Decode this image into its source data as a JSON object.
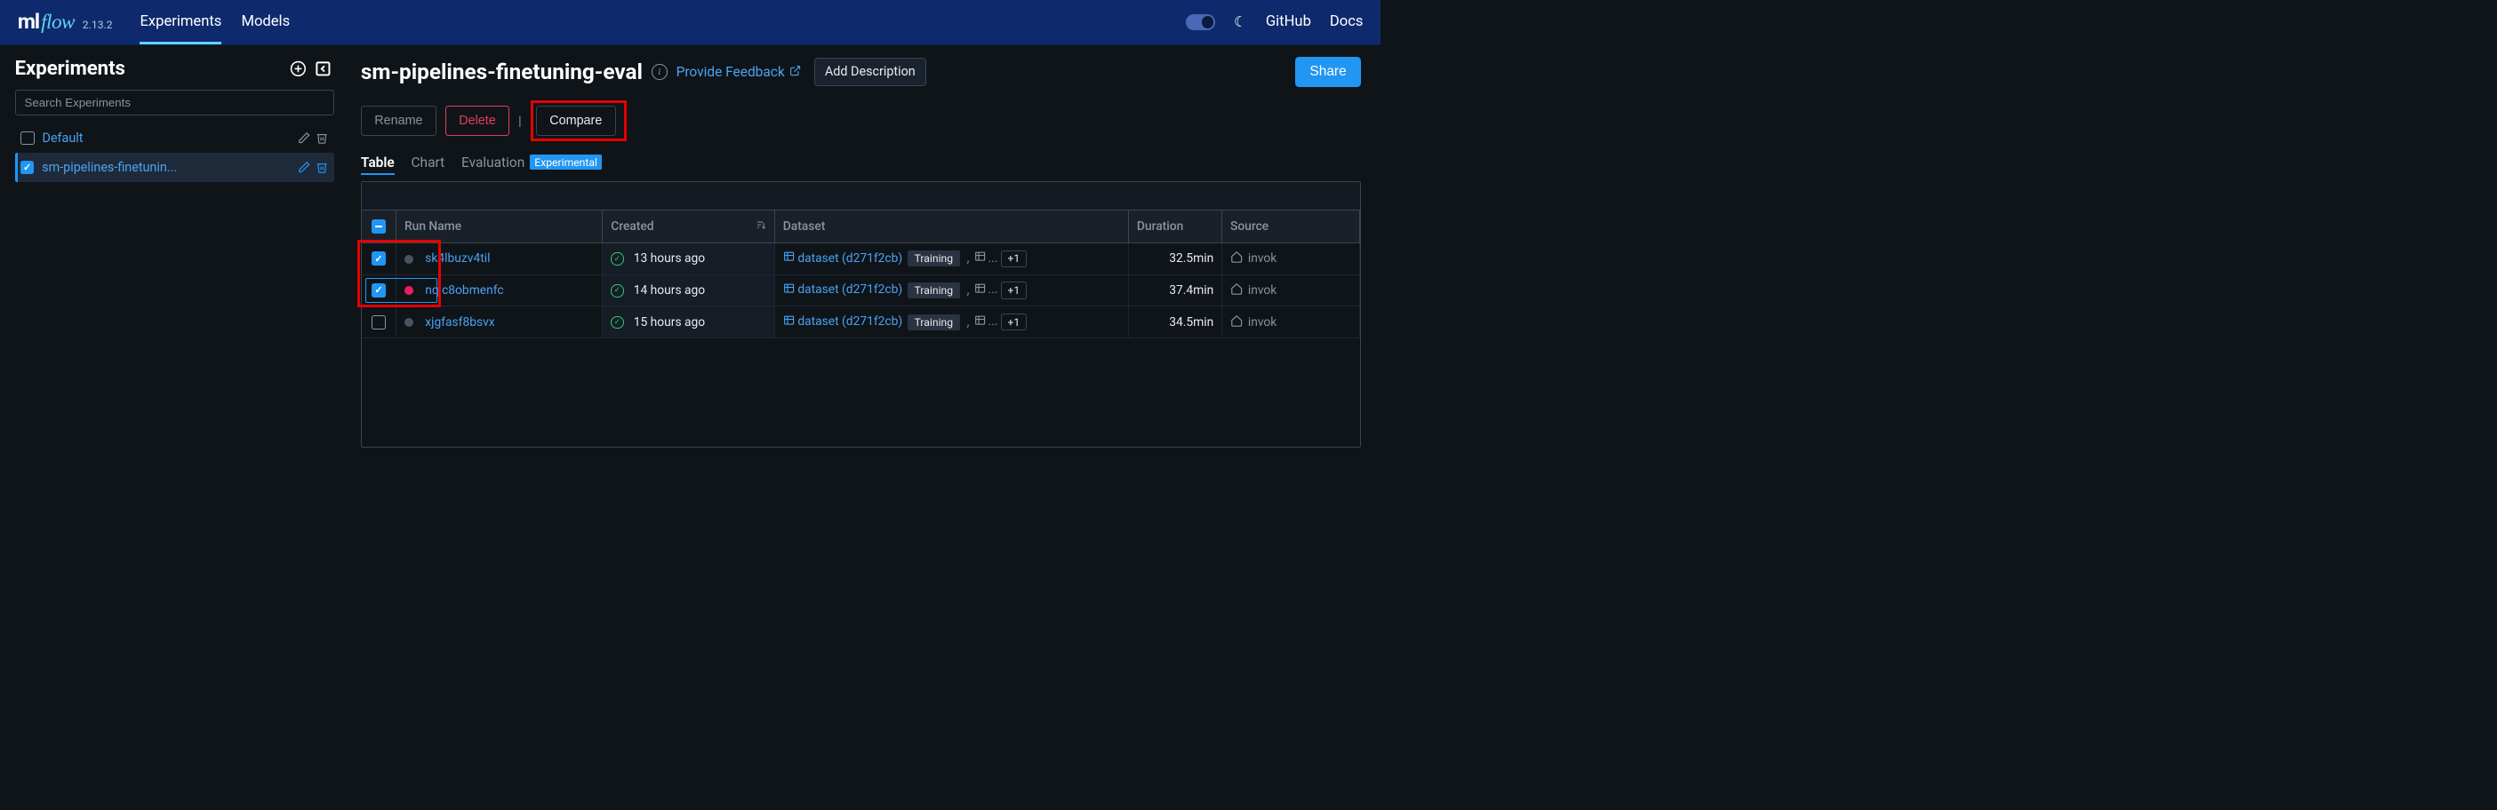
{
  "header": {
    "logo_ml": "ml",
    "logo_flow": "flow",
    "version": "2.13.2",
    "nav": {
      "experiments": "Experiments",
      "models": "Models"
    },
    "github": "GitHub",
    "docs": "Docs"
  },
  "sidebar": {
    "title": "Experiments",
    "search_placeholder": "Search Experiments",
    "items": [
      {
        "name": "Default",
        "checked": false,
        "active": false
      },
      {
        "name": "sm-pipelines-finetunin...",
        "checked": true,
        "active": true
      }
    ]
  },
  "main": {
    "title": "sm-pipelines-finetuning-eval",
    "feedback": "Provide Feedback",
    "add_description": "Add Description",
    "share": "Share",
    "buttons": {
      "rename": "Rename",
      "delete": "Delete",
      "compare": "Compare"
    },
    "tabs": {
      "table": "Table",
      "chart": "Chart",
      "evaluation": "Evaluation",
      "exp_badge": "Experimental"
    },
    "columns": {
      "run_name": "Run Name",
      "created": "Created",
      "dataset": "Dataset",
      "duration": "Duration",
      "source": "Source"
    },
    "rows": [
      {
        "checked": true,
        "dot": "grey",
        "name": "sk4lbuzv4til",
        "created": "13 hours ago",
        "dataset": "dataset (d271f2cb)",
        "tag": "Training",
        "more": "+1",
        "duration": "32.5min",
        "source": "invok"
      },
      {
        "checked": true,
        "dot": "pink",
        "name": "nqjc8obmenfc",
        "created": "14 hours ago",
        "dataset": "dataset (d271f2cb)",
        "tag": "Training",
        "more": "+1",
        "duration": "37.4min",
        "source": "invok"
      },
      {
        "checked": false,
        "dot": "grey",
        "name": "xjgfasf8bsvx",
        "created": "15 hours ago",
        "dataset": "dataset (d271f2cb)",
        "tag": "Training",
        "more": "+1",
        "duration": "34.5min",
        "source": "invok"
      }
    ]
  }
}
